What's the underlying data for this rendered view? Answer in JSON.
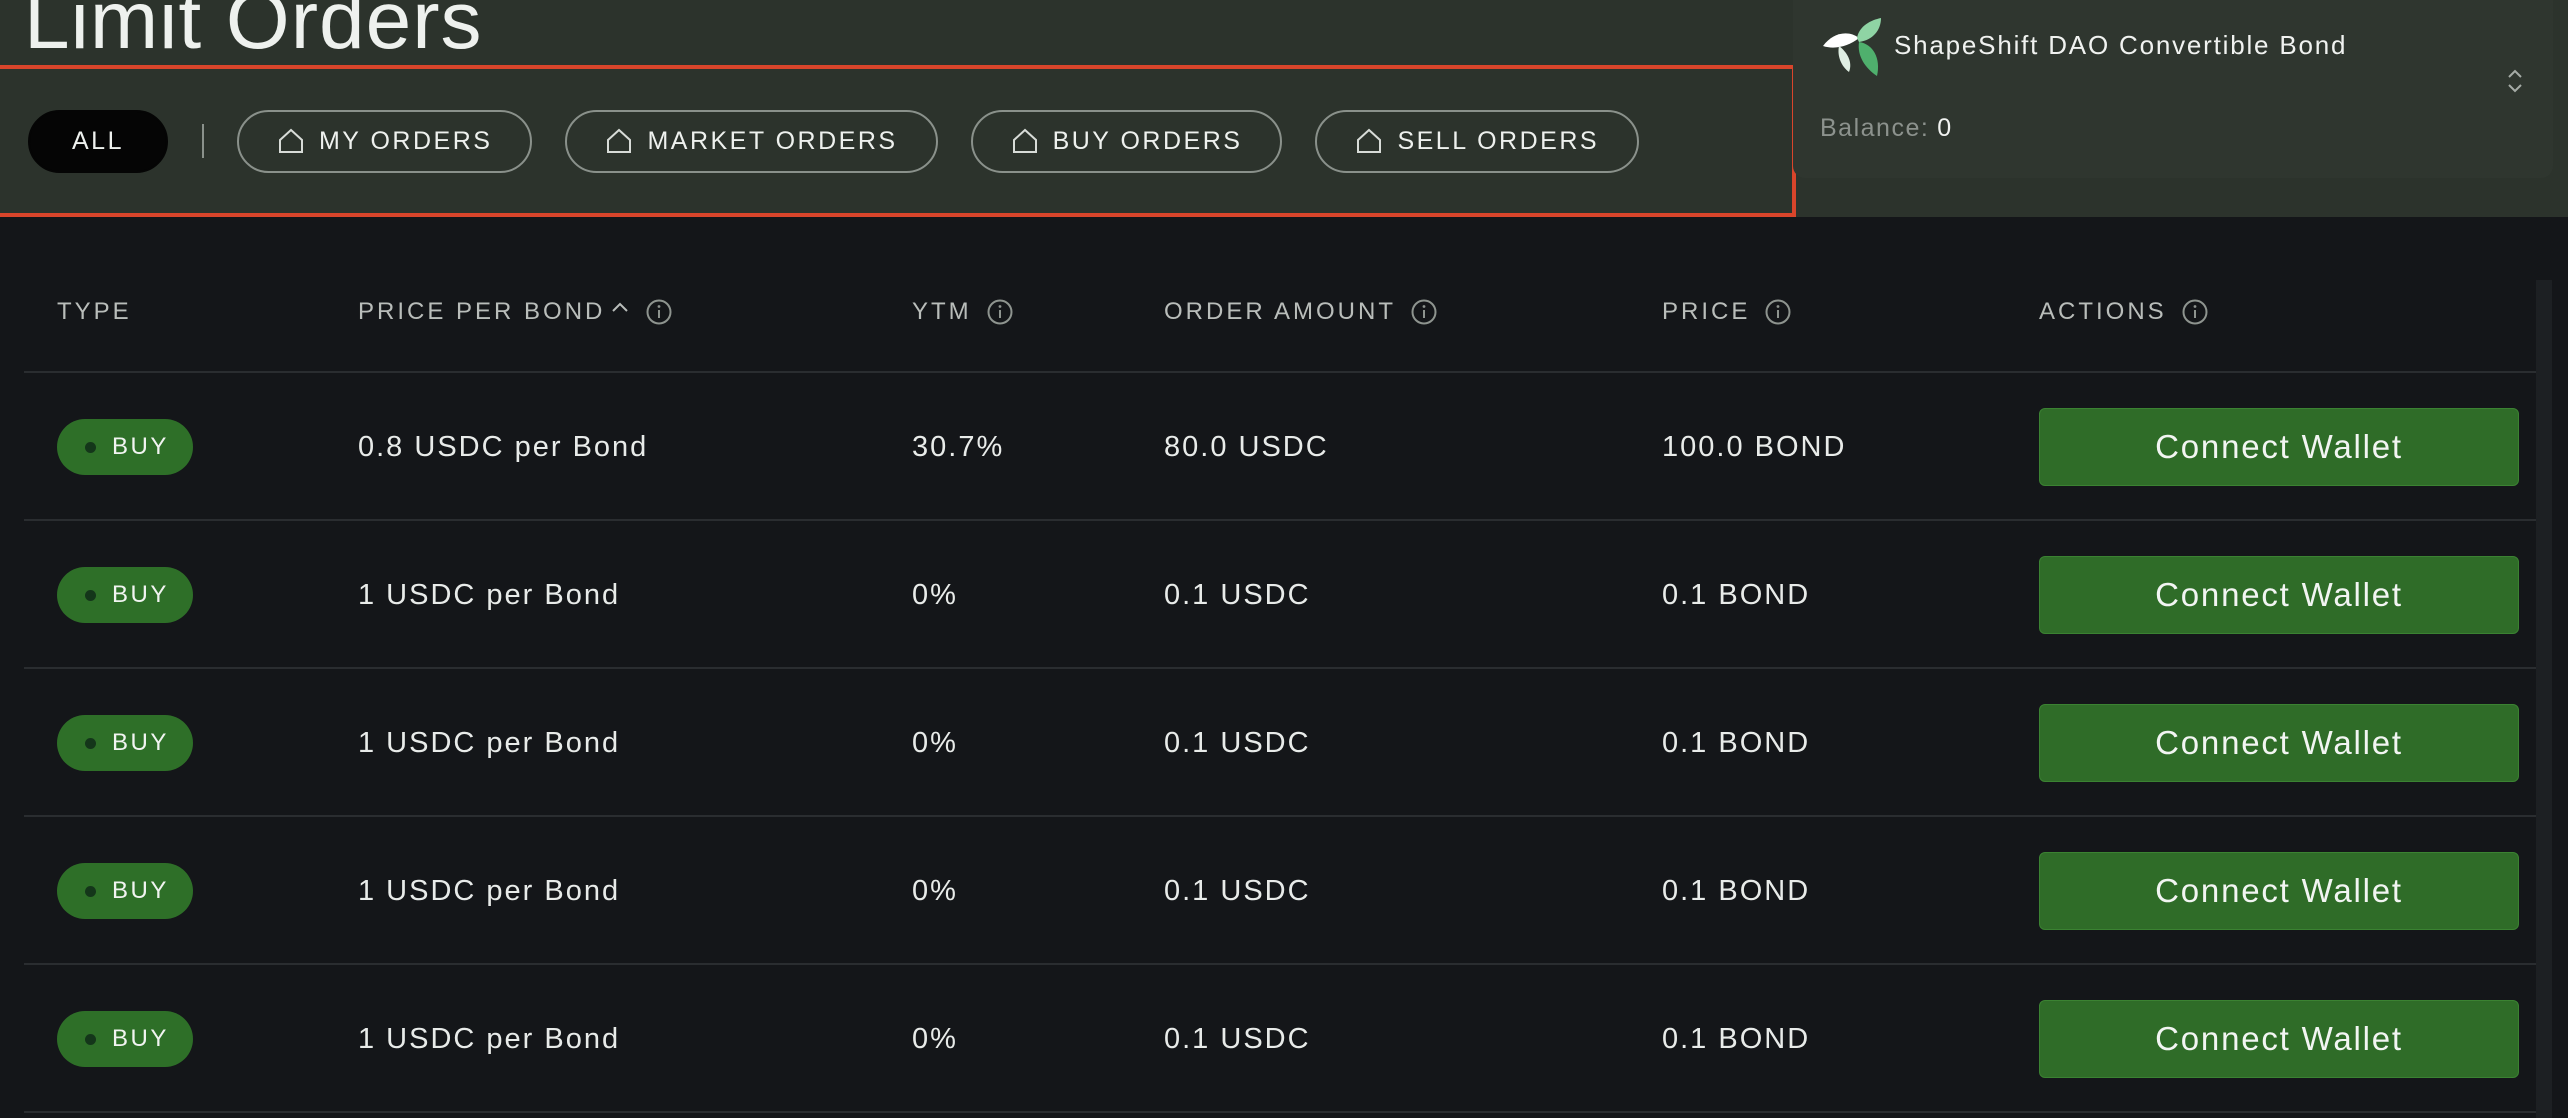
{
  "page": {
    "title": "Limit Orders"
  },
  "filters": {
    "items": [
      {
        "label": "ALL",
        "active": true,
        "icon": null
      },
      {
        "label": "MY ORDERS",
        "active": false,
        "icon": "house-icon"
      },
      {
        "label": "MARKET ORDERS",
        "active": false,
        "icon": "house-icon"
      },
      {
        "label": "BUY ORDERS",
        "active": false,
        "icon": "house-icon"
      },
      {
        "label": "SELL ORDERS",
        "active": false,
        "icon": "house-icon"
      }
    ]
  },
  "bond_selector": {
    "name": "ShapeShift DAO Convertible Bond",
    "balance_label": "Balance:",
    "balance_value": "0",
    "logo_icon": "shapeshift-fox-logo",
    "chevron_icon": "chevron-up-down-icon"
  },
  "table": {
    "columns": [
      {
        "label": "TYPE",
        "info": false,
        "sort": null
      },
      {
        "label": "PRICE PER BOND",
        "info": true,
        "sort": "ascending"
      },
      {
        "label": "YTM",
        "info": true,
        "sort": null
      },
      {
        "label": "ORDER AMOUNT",
        "info": true,
        "sort": null
      },
      {
        "label": "PRICE",
        "info": true,
        "sort": null
      },
      {
        "label": "ACTIONS",
        "info": true,
        "sort": null
      }
    ],
    "rows": [
      {
        "type": "BUY",
        "price_per_bond": "0.8 USDC per Bond",
        "ytm": "30.7%",
        "order_amount": "80.0 USDC",
        "price": "100.0 BOND",
        "action": "Connect Wallet"
      },
      {
        "type": "BUY",
        "price_per_bond": "1 USDC per Bond",
        "ytm": "0%",
        "order_amount": "0.1 USDC",
        "price": "0.1 BOND",
        "action": "Connect Wallet"
      },
      {
        "type": "BUY",
        "price_per_bond": "1 USDC per Bond",
        "ytm": "0%",
        "order_amount": "0.1 USDC",
        "price": "0.1 BOND",
        "action": "Connect Wallet"
      },
      {
        "type": "BUY",
        "price_per_bond": "1 USDC per Bond",
        "ytm": "0%",
        "order_amount": "0.1 USDC",
        "price": "0.1 BOND",
        "action": "Connect Wallet"
      },
      {
        "type": "BUY",
        "price_per_bond": "1 USDC per Bond",
        "ytm": "0%",
        "order_amount": "0.1 USDC",
        "price": "0.1 BOND",
        "action": "Connect Wallet"
      }
    ]
  },
  "colors": {
    "header_bg": "#2c332c",
    "page_bg": "#141619",
    "highlight_border": "#d9452b",
    "buy_badge": "#2e6f28",
    "connect_button": "#2f6c28"
  }
}
